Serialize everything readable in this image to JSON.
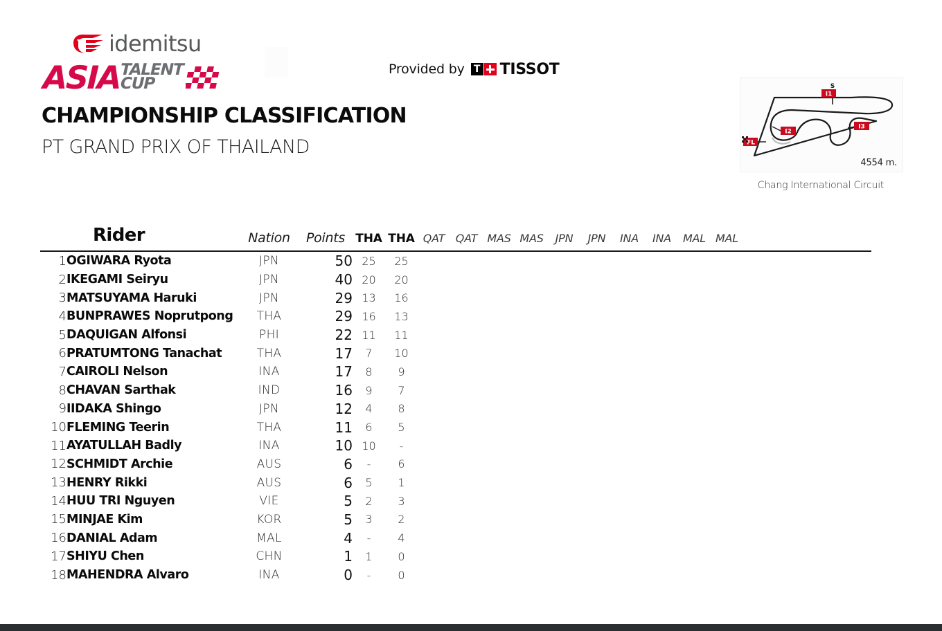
{
  "brand": {
    "idemitsu_word": "idemitsu",
    "asia": "ASIA",
    "talent": "TALENT",
    "cup": "CUP"
  },
  "header": {
    "title": "CHAMPIONSHIP CLASSIFICATION",
    "subtitle": "PT GRAND PRIX OF THAILAND",
    "provided_by": "Provided by",
    "timing_partner_t": "T",
    "timing_partner": "TISSOT"
  },
  "circuit": {
    "name": "Chang International Circuit",
    "length": "4554 m.",
    "markers": [
      {
        "id": "S",
        "label": "S"
      },
      {
        "id": "I1",
        "label": "I1"
      },
      {
        "id": "I2",
        "label": "I2"
      },
      {
        "id": "I3",
        "label": "I3"
      },
      {
        "id": "FL",
        "label": "FL"
      }
    ],
    "marker_color": "#cc0a1e"
  },
  "table": {
    "headers": {
      "rider": "Rider",
      "nation": "Nation",
      "points": "Points"
    },
    "rounds": [
      {
        "label": "THA",
        "raced": true
      },
      {
        "label": "THA",
        "raced": true
      },
      {
        "label": "QAT",
        "raced": false
      },
      {
        "label": "QAT",
        "raced": false
      },
      {
        "label": "MAS",
        "raced": false
      },
      {
        "label": "MAS",
        "raced": false
      },
      {
        "label": "JPN",
        "raced": false
      },
      {
        "label": "JPN",
        "raced": false
      },
      {
        "label": "INA",
        "raced": false
      },
      {
        "label": "INA",
        "raced": false
      },
      {
        "label": "MAL",
        "raced": false
      },
      {
        "label": "MAL",
        "raced": false
      }
    ],
    "rows": [
      {
        "pos": "1",
        "rider": "OGIWARA Ryota",
        "nation": "JPN",
        "points": "50",
        "scores": [
          "25",
          "25",
          "",
          "",
          "",
          "",
          "",
          "",
          "",
          "",
          "",
          ""
        ]
      },
      {
        "pos": "2",
        "rider": "IKEGAMI Seiryu",
        "nation": "JPN",
        "points": "40",
        "scores": [
          "20",
          "20",
          "",
          "",
          "",
          "",
          "",
          "",
          "",
          "",
          "",
          ""
        ]
      },
      {
        "pos": "3",
        "rider": "MATSUYAMA Haruki",
        "nation": "JPN",
        "points": "29",
        "scores": [
          "13",
          "16",
          "",
          "",
          "",
          "",
          "",
          "",
          "",
          "",
          "",
          ""
        ]
      },
      {
        "pos": "4",
        "rider": "BUNPRAWES Noprutpong",
        "nation": "THA",
        "points": "29",
        "scores": [
          "16",
          "13",
          "",
          "",
          "",
          "",
          "",
          "",
          "",
          "",
          "",
          ""
        ]
      },
      {
        "pos": "5",
        "rider": "DAQUIGAN Alfonsi",
        "nation": "PHI",
        "points": "22",
        "scores": [
          "11",
          "11",
          "",
          "",
          "",
          "",
          "",
          "",
          "",
          "",
          "",
          ""
        ]
      },
      {
        "pos": "6",
        "rider": "PRATUMTONG Tanachat",
        "nation": "THA",
        "points": "17",
        "scores": [
          "7",
          "10",
          "",
          "",
          "",
          "",
          "",
          "",
          "",
          "",
          "",
          ""
        ]
      },
      {
        "pos": "7",
        "rider": "CAIROLI Nelson",
        "nation": "INA",
        "points": "17",
        "scores": [
          "8",
          "9",
          "",
          "",
          "",
          "",
          "",
          "",
          "",
          "",
          "",
          ""
        ]
      },
      {
        "pos": "8",
        "rider": "CHAVAN Sarthak",
        "nation": "IND",
        "points": "16",
        "scores": [
          "9",
          "7",
          "",
          "",
          "",
          "",
          "",
          "",
          "",
          "",
          "",
          ""
        ]
      },
      {
        "pos": "9",
        "rider": "IIDAKA Shingo",
        "nation": "JPN",
        "points": "12",
        "scores": [
          "4",
          "8",
          "",
          "",
          "",
          "",
          "",
          "",
          "",
          "",
          "",
          ""
        ]
      },
      {
        "pos": "10",
        "rider": "FLEMING Teerin",
        "nation": "THA",
        "points": "11",
        "scores": [
          "6",
          "5",
          "",
          "",
          "",
          "",
          "",
          "",
          "",
          "",
          "",
          ""
        ]
      },
      {
        "pos": "11",
        "rider": "AYATULLAH Badly",
        "nation": "INA",
        "points": "10",
        "scores": [
          "10",
          "-",
          "",
          "",
          "",
          "",
          "",
          "",
          "",
          "",
          "",
          ""
        ]
      },
      {
        "pos": "12",
        "rider": "SCHMIDT Archie",
        "nation": "AUS",
        "points": "6",
        "scores": [
          "-",
          "6",
          "",
          "",
          "",
          "",
          "",
          "",
          "",
          "",
          "",
          ""
        ]
      },
      {
        "pos": "13",
        "rider": "HENRY Rikki",
        "nation": "AUS",
        "points": "6",
        "scores": [
          "5",
          "1",
          "",
          "",
          "",
          "",
          "",
          "",
          "",
          "",
          "",
          ""
        ]
      },
      {
        "pos": "14",
        "rider": "HUU TRI Nguyen",
        "nation": "VIE",
        "points": "5",
        "scores": [
          "2",
          "3",
          "",
          "",
          "",
          "",
          "",
          "",
          "",
          "",
          "",
          ""
        ]
      },
      {
        "pos": "15",
        "rider": "MINJAE Kim",
        "nation": "KOR",
        "points": "5",
        "scores": [
          "3",
          "2",
          "",
          "",
          "",
          "",
          "",
          "",
          "",
          "",
          "",
          ""
        ]
      },
      {
        "pos": "16",
        "rider": "DANIAL Adam",
        "nation": "MAL",
        "points": "4",
        "scores": [
          "-",
          "4",
          "",
          "",
          "",
          "",
          "",
          "",
          "",
          "",
          "",
          ""
        ]
      },
      {
        "pos": "17",
        "rider": "SHIYU Chen",
        "nation": "CHN",
        "points": "1",
        "scores": [
          "1",
          "0",
          "",
          "",
          "",
          "",
          "",
          "",
          "",
          "",
          "",
          ""
        ]
      },
      {
        "pos": "18",
        "rider": "MAHENDRA Alvaro",
        "nation": "INA",
        "points": "0",
        "scores": [
          "-",
          "0",
          "",
          "",
          "",
          "",
          "",
          "",
          "",
          "",
          "",
          ""
        ]
      }
    ]
  },
  "colors": {
    "idemitsu_red": "#e2001a",
    "atc_red": "#d6094b",
    "atc_grey": "#6d6e71",
    "tissot_red": "#e2001a",
    "footer": "#2b2e31"
  }
}
